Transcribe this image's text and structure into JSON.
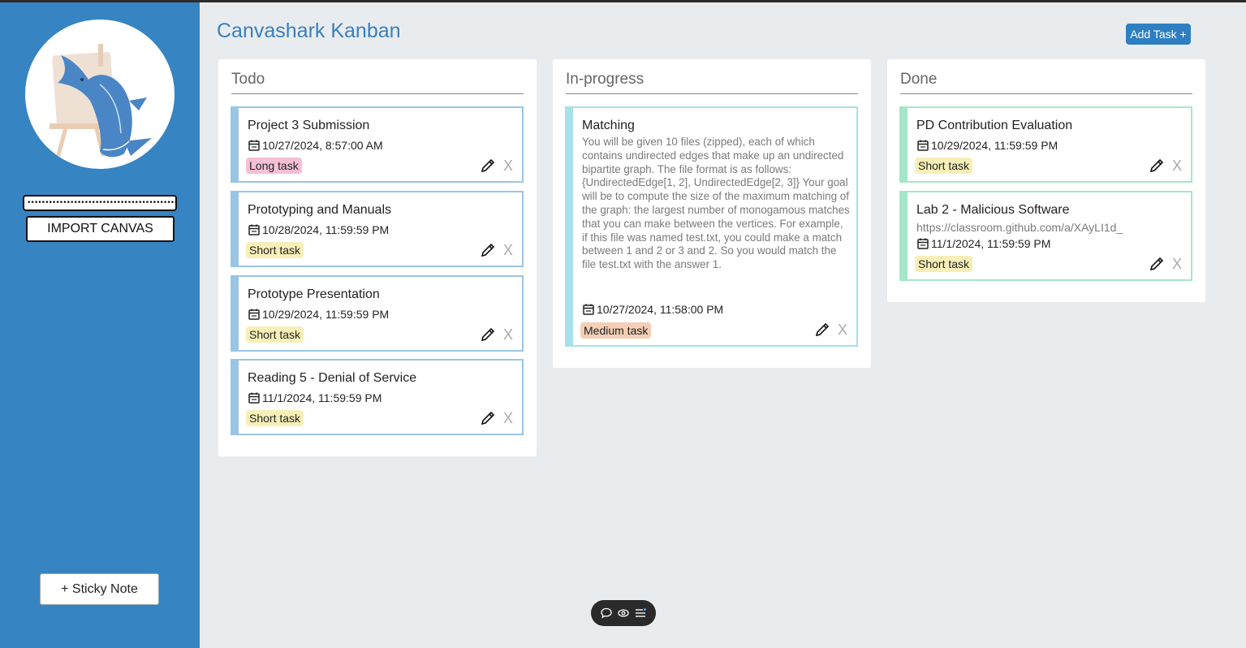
{
  "app": {
    "title": "Canvashark Kanban",
    "add_task_label": "Add Task +"
  },
  "sidebar": {
    "token_value": "••••••••••••••••••••••••••••••••••••••••••••",
    "import_label": "IMPORT CANVAS",
    "sticky_label": "+ Sticky Note"
  },
  "columns": [
    {
      "title": "Todo",
      "cards": [
        {
          "title": "Project 3 Submission",
          "date": "10/27/2024, 8:57:00 AM",
          "tag": "Long task"
        },
        {
          "title": "Prototyping and Manuals",
          "date": "10/28/2024, 11:59:59 PM",
          "tag": "Short task"
        },
        {
          "title": "Prototype Presentation",
          "date": "10/29/2024, 11:59:59 PM",
          "tag": "Short task"
        },
        {
          "title": "Reading 5 - Denial of Service",
          "date": "11/1/2024, 11:59:59 PM",
          "tag": "Short task"
        }
      ]
    },
    {
      "title": "In-progress",
      "cards": [
        {
          "title": "Matching",
          "description": "You will be given 10 files (zipped), each of which contains undirected edges that make up an undirected bipartite graph. The file format is as follows: {UndirectedEdge[1, 2], UndirectedEdge[2, 3]} Your goal will be to compute the size of the maximum matching of the graph: the largest number of monogamous matches that you can make between the vertices. For example, if this file was named test.txt, you could make a match between 1 and 2 or 3 and 2. So you would match the file test.txt with the answer 1.",
          "date": "10/27/2024, 11:58:00 PM",
          "tag": "Medium task"
        }
      ]
    },
    {
      "title": "Done",
      "cards": [
        {
          "title": "PD Contribution Evaluation",
          "date": "10/29/2024, 11:59:59 PM",
          "tag": "Short task"
        },
        {
          "title": "Lab 2 - Malicious Software",
          "url": "https://classroom.github.com/a/XAyLI1d_",
          "date": "11/1/2024, 11:59:59 PM",
          "tag": "Short task"
        }
      ]
    }
  ],
  "card_delete_label": "X",
  "colors": {
    "sidebar": "#3784c2",
    "background": "#e9ecef",
    "title": "#3a7fbc",
    "accent_button": "#2d7fc1",
    "todo_border": "#9ac5e5",
    "inprogress_border": "#a8e0e9",
    "done_border": "#a6e6c8",
    "tag_long": "#f5c0d6",
    "tag_short": "#f7efb8",
    "tag_medium": "#f4cfb5"
  },
  "icons": [
    "shark-logo",
    "calendar-icon",
    "pencil-icon",
    "chat-icon",
    "eye-icon",
    "list-icon"
  ]
}
